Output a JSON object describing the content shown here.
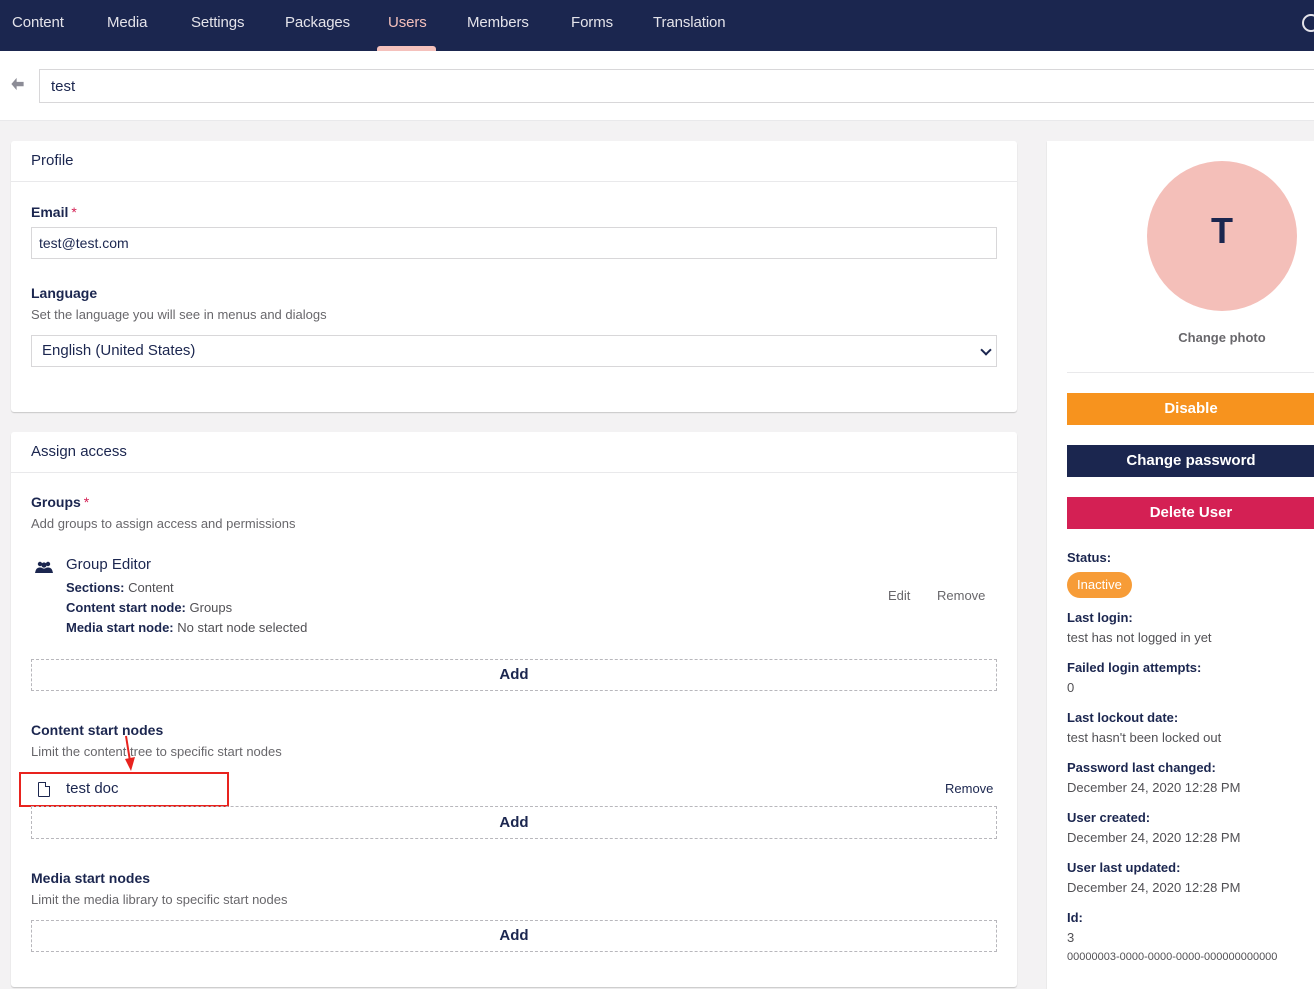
{
  "nav": {
    "items": [
      "Content",
      "Media",
      "Settings",
      "Packages",
      "Users",
      "Members",
      "Forms",
      "Translation"
    ],
    "active": "Users"
  },
  "header": {
    "name_value": "test"
  },
  "profile": {
    "title": "Profile",
    "email_label": "Email",
    "required_mark": "*",
    "email_value": "test@test.com",
    "language_label": "Language",
    "language_desc": "Set the language you will see in menus and dialogs",
    "language_value": "English (United States)"
  },
  "access": {
    "title": "Assign access",
    "groups_label": "Groups",
    "groups_desc": "Add groups to assign access and permissions",
    "group": {
      "name": "Group Editor",
      "sections_label": "Sections:",
      "sections_value": "Content",
      "content_start_label": "Content start node:",
      "content_start_value": "Groups",
      "media_start_label": "Media start node:",
      "media_start_value": "No start node selected",
      "edit": "Edit",
      "remove": "Remove"
    },
    "add": "Add",
    "content_nodes_label": "Content start nodes",
    "content_nodes_desc": "Limit the content tree to specific start nodes",
    "content_node": {
      "name": "test doc",
      "remove": "Remove"
    },
    "media_nodes_label": "Media start nodes",
    "media_nodes_desc": "Limit the media library to specific start nodes"
  },
  "side": {
    "avatar_letter": "T",
    "change_photo": "Change photo",
    "disable": "Disable",
    "change_password": "Change password",
    "delete_user": "Delete User",
    "status_label": "Status:",
    "status_value": "Inactive",
    "last_login_label": "Last login:",
    "last_login_value": "test has not logged in yet",
    "failed_label": "Failed login attempts:",
    "failed_value": "0",
    "lockout_label": "Last lockout date:",
    "lockout_value": "test hasn't been locked out",
    "pwd_changed_label": "Password last changed:",
    "pwd_changed_value": "December 24, 2020 12:28 PM",
    "created_label": "User created:",
    "created_value": "December 24, 2020 12:28 PM",
    "updated_label": "User last updated:",
    "updated_value": "December 24, 2020 12:28 PM",
    "id_label": "Id:",
    "id_value": "3",
    "guid_value": "00000003-0000-0000-0000-000000000000"
  },
  "colors": {
    "nav_bg": "#1b264f",
    "nav_active": "#f5c1bc",
    "disable": "#f7931e",
    "change_password": "#1b264f",
    "delete": "#d42054",
    "status_badge": "#f79c37",
    "annotation": "#e8231e"
  }
}
